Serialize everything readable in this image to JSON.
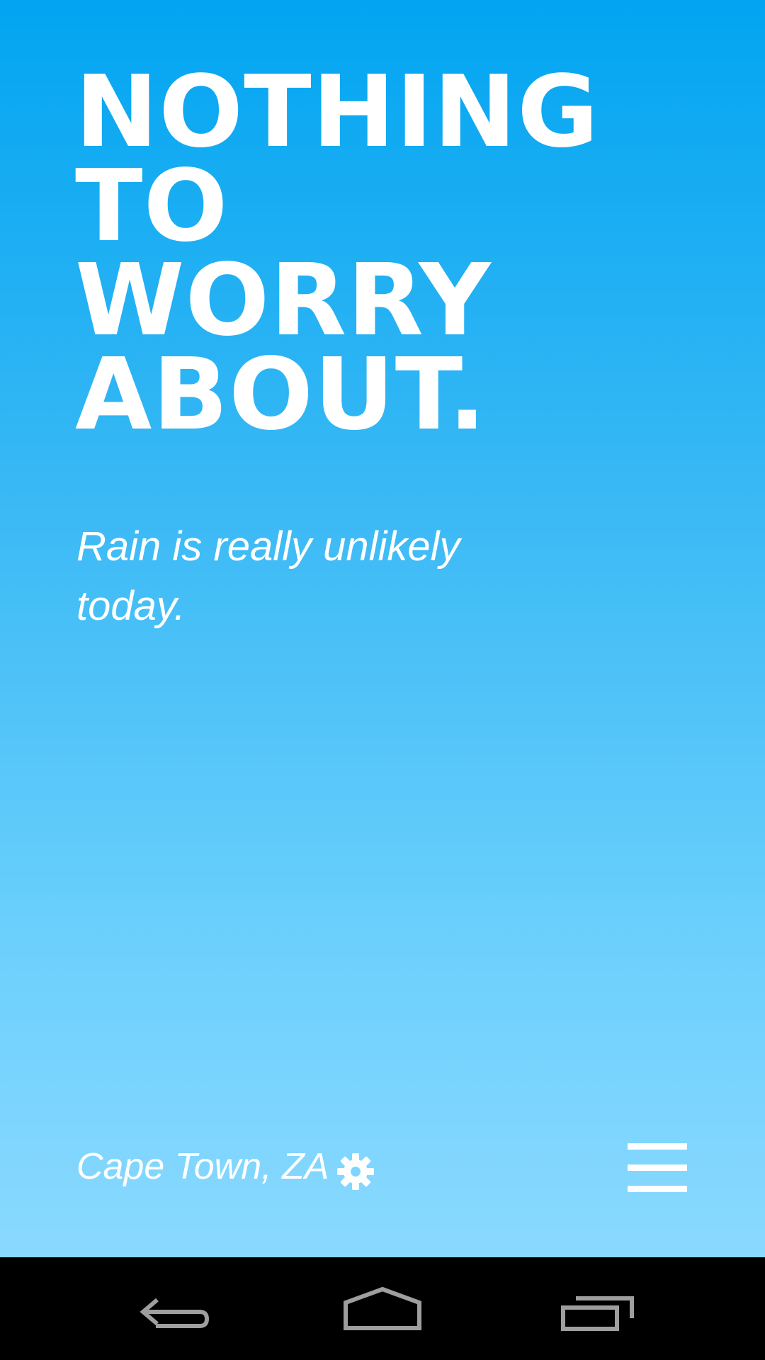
{
  "main": {
    "headline_lines": [
      "NOTHING",
      "TO",
      "WORRY",
      "ABOUT."
    ],
    "subtitle": "Rain is really unlikely today."
  },
  "footer": {
    "location": "Cape Town, ZA",
    "settings_icon": "gear-icon",
    "menu_icon": "hamburger-menu-icon"
  },
  "system_nav": {
    "back_icon": "back-icon",
    "home_icon": "home-icon",
    "recents_icon": "recent-apps-icon"
  },
  "colors": {
    "gradient_top": "#02a5f1",
    "gradient_bottom": "#8ad9ff",
    "text": "#ffffff",
    "nav_background": "#000000",
    "nav_icon": "#9e9e9e"
  }
}
